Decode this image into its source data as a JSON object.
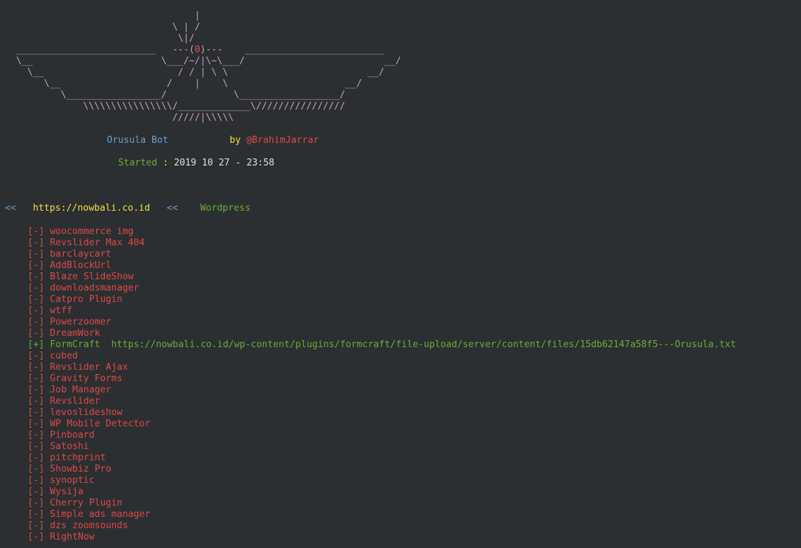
{
  "banner": {
    "art_lines": [
      "                                  |",
      "                              \\ | /",
      "                               \\|/",
      "  _________________________   ---(",
      "  \\__                       \\___/~/|\\~\\___/                         __/",
      "    \\__                        / / | \\ \\                         __/",
      "       \\__                   /    |    \\                     __/",
      "          \\_________________/            \\__________________/",
      "              \\\\\\\\\\\\\\\\\\\\\\\\\\\\\\\\/_____________\\////////////////",
      "                              /////|\\\\\\\\\\"
    ],
    "eye": "0",
    "eye_suffix": ")---    _________________________"
  },
  "header": {
    "bot_name": "Orusula Bot",
    "by_label": "by",
    "author": "@BrahimJarrar",
    "started_label": "Started",
    "colon": ":",
    "started_value": "2019 10 27 - 23:58"
  },
  "target": {
    "arrow_left": "<<",
    "url": "https://nowbali.co.id",
    "arrow_right": "<<",
    "cms": "Wordpress"
  },
  "results": [
    {
      "status": "[-]",
      "name": "woocommerce img",
      "ok": false,
      "link": ""
    },
    {
      "status": "[-]",
      "name": "Revslider Max 404",
      "ok": false,
      "link": ""
    },
    {
      "status": "[-]",
      "name": "barclaycart",
      "ok": false,
      "link": ""
    },
    {
      "status": "[-]",
      "name": "AddBlockUrl",
      "ok": false,
      "link": ""
    },
    {
      "status": "[-]",
      "name": "Blaze SlideShow",
      "ok": false,
      "link": ""
    },
    {
      "status": "[-]",
      "name": "downloadsmanager",
      "ok": false,
      "link": ""
    },
    {
      "status": "[-]",
      "name": "Catpro Plugin",
      "ok": false,
      "link": ""
    },
    {
      "status": "[-]",
      "name": "wtff",
      "ok": false,
      "link": ""
    },
    {
      "status": "[-]",
      "name": "Powerzoomer",
      "ok": false,
      "link": ""
    },
    {
      "status": "[-]",
      "name": "DreamWork",
      "ok": false,
      "link": ""
    },
    {
      "status": "[+]",
      "name": "FormCraft",
      "ok": true,
      "link": "https://nowbali.co.id/wp-content/plugins/formcraft/file-upload/server/content/files/15db62147a58f5---Orusula.txt"
    },
    {
      "status": "[-]",
      "name": "cubed",
      "ok": false,
      "link": ""
    },
    {
      "status": "[-]",
      "name": "Revslider Ajax",
      "ok": false,
      "link": ""
    },
    {
      "status": "[-]",
      "name": "Gravity Forms",
      "ok": false,
      "link": ""
    },
    {
      "status": "[-]",
      "name": "Job Manager",
      "ok": false,
      "link": ""
    },
    {
      "status": "[-]",
      "name": "Revslider",
      "ok": false,
      "link": ""
    },
    {
      "status": "[-]",
      "name": "levoslideshow",
      "ok": false,
      "link": ""
    },
    {
      "status": "[-]",
      "name": "WP Mobile Detector",
      "ok": false,
      "link": ""
    },
    {
      "status": "[-]",
      "name": "Pinboard",
      "ok": false,
      "link": ""
    },
    {
      "status": "[-]",
      "name": "Satoshi",
      "ok": false,
      "link": ""
    },
    {
      "status": "[-]",
      "name": "pitchprint",
      "ok": false,
      "link": ""
    },
    {
      "status": "[-]",
      "name": "Showbiz Pro",
      "ok": false,
      "link": ""
    },
    {
      "status": "[-]",
      "name": "synoptic",
      "ok": false,
      "link": ""
    },
    {
      "status": "[-]",
      "name": "Wysija",
      "ok": false,
      "link": ""
    },
    {
      "status": "[-]",
      "name": "Cherry Plugin",
      "ok": false,
      "link": ""
    },
    {
      "status": "[-]",
      "name": "Simple ads manager",
      "ok": false,
      "link": ""
    },
    {
      "status": "[-]",
      "name": "dzs zoomsounds",
      "ok": false,
      "link": ""
    },
    {
      "status": "[-]",
      "name": "RightNow",
      "ok": false,
      "link": ""
    }
  ],
  "colors": {
    "background": "#2b2f31",
    "fail": "#e04848",
    "success": "#6aad3a",
    "accent_blue": "#6e9fd0",
    "url_yellow": "#f0e040"
  }
}
